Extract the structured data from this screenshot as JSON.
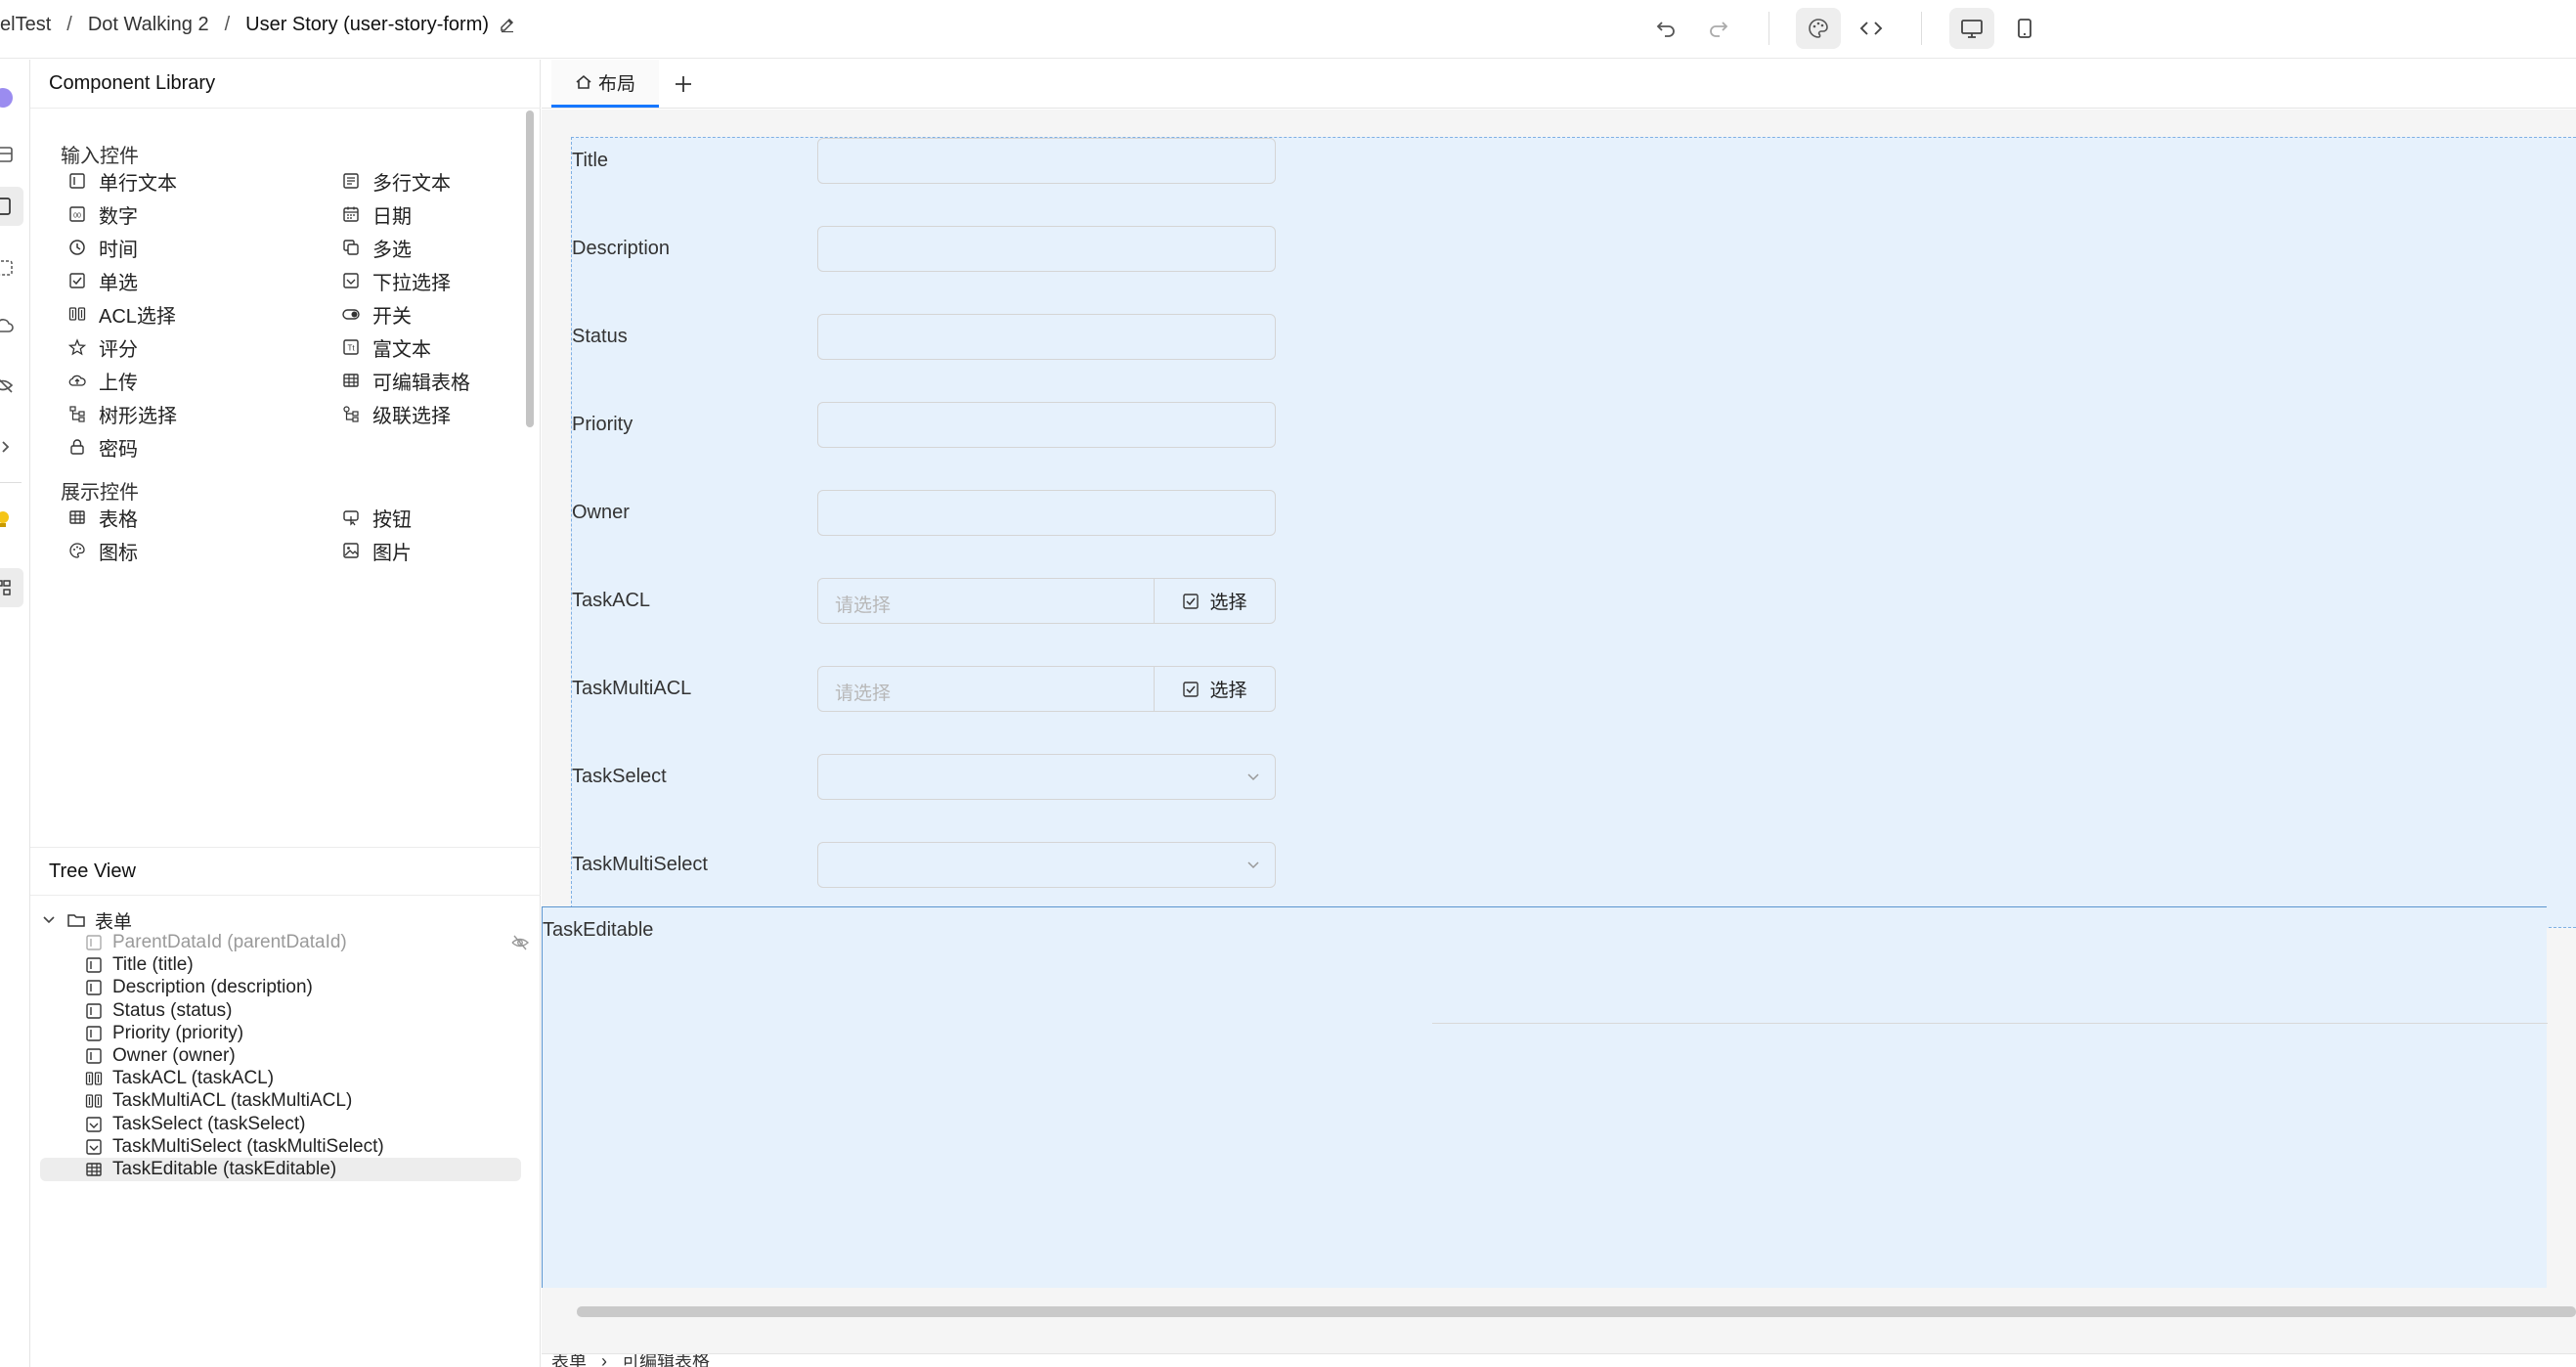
{
  "breadcrumb": {
    "items": [
      "elTest",
      "Dot Walking 2",
      "User Story (user-story-form)"
    ],
    "separator": "/"
  },
  "toolbar": {
    "undo": "undo-icon",
    "redo": "redo-icon",
    "theme": "palette-icon",
    "code": "code-icon",
    "desktop": "desktop-icon",
    "mobile": "mobile-icon"
  },
  "component_library": {
    "title": "Component Library",
    "input_group_title": "输入控件",
    "input_items": [
      {
        "label": "单行文本",
        "icon": "input-icon"
      },
      {
        "label": "多行文本",
        "icon": "textarea-icon"
      },
      {
        "label": "数字",
        "icon": "number-icon"
      },
      {
        "label": "日期",
        "icon": "calendar-icon"
      },
      {
        "label": "时间",
        "icon": "clock-icon"
      },
      {
        "label": "多选",
        "icon": "copy-icon"
      },
      {
        "label": "单选",
        "icon": "checkbox-icon"
      },
      {
        "label": "下拉选择",
        "icon": "select-icon"
      },
      {
        "label": "ACL选择",
        "icon": "acl-icon"
      },
      {
        "label": "开关",
        "icon": "toggle-icon"
      },
      {
        "label": "评分",
        "icon": "star-icon"
      },
      {
        "label": "富文本",
        "icon": "richtext-icon"
      },
      {
        "label": "上传",
        "icon": "upload-icon"
      },
      {
        "label": "可编辑表格",
        "icon": "table-icon"
      },
      {
        "label": "树形选择",
        "icon": "tree-icon"
      },
      {
        "label": "级联选择",
        "icon": "cascade-icon"
      },
      {
        "label": "密码",
        "icon": "lock-icon"
      }
    ],
    "display_group_title": "展示控件",
    "display_items": [
      {
        "label": "表格",
        "icon": "table-icon"
      },
      {
        "label": "按钮",
        "icon": "button-icon"
      },
      {
        "label": "图标",
        "icon": "palette-icon"
      },
      {
        "label": "图片",
        "icon": "image-icon"
      }
    ]
  },
  "tree_view": {
    "title": "Tree View",
    "root": "表单",
    "nodes": [
      {
        "label": "ParentDataId (parentDataId)",
        "icon": "input-icon",
        "disabled": true
      },
      {
        "label": "Title (title)",
        "icon": "input-icon"
      },
      {
        "label": "Description (description)",
        "icon": "input-icon"
      },
      {
        "label": "Status (status)",
        "icon": "input-icon"
      },
      {
        "label": "Priority (priority)",
        "icon": "input-icon"
      },
      {
        "label": "Owner (owner)",
        "icon": "input-icon"
      },
      {
        "label": "TaskACL (taskACL)",
        "icon": "acl-icon"
      },
      {
        "label": "TaskMultiACL (taskMultiACL)",
        "icon": "acl-icon"
      },
      {
        "label": "TaskSelect (taskSelect)",
        "icon": "select-icon"
      },
      {
        "label": "TaskMultiSelect (taskMultiSelect)",
        "icon": "select-icon"
      },
      {
        "label": "TaskEditable (taskEditable)",
        "icon": "table-icon",
        "selected": true
      }
    ]
  },
  "tabs": {
    "layout_tab": "布局",
    "add": "plus-icon"
  },
  "form": {
    "fields": [
      {
        "label": "Title",
        "type": "input"
      },
      {
        "label": "Description",
        "type": "input"
      },
      {
        "label": "Status",
        "type": "input"
      },
      {
        "label": "Priority",
        "type": "input"
      },
      {
        "label": "Owner",
        "type": "input"
      },
      {
        "label": "TaskACL",
        "type": "acl",
        "placeholder": "请选择",
        "button": "选择"
      },
      {
        "label": "TaskMultiACL",
        "type": "acl",
        "placeholder": "请选择",
        "button": "选择"
      },
      {
        "label": "TaskSelect",
        "type": "select"
      },
      {
        "label": "TaskMultiSelect",
        "type": "select"
      }
    ],
    "editable_label": "TaskEditable"
  },
  "status_path": [
    "表单",
    "可编辑表格"
  ],
  "colors": {
    "accent": "#1677ff",
    "canvas_bg": "#f5f5f5",
    "form_bg": "#e6f1fc"
  }
}
